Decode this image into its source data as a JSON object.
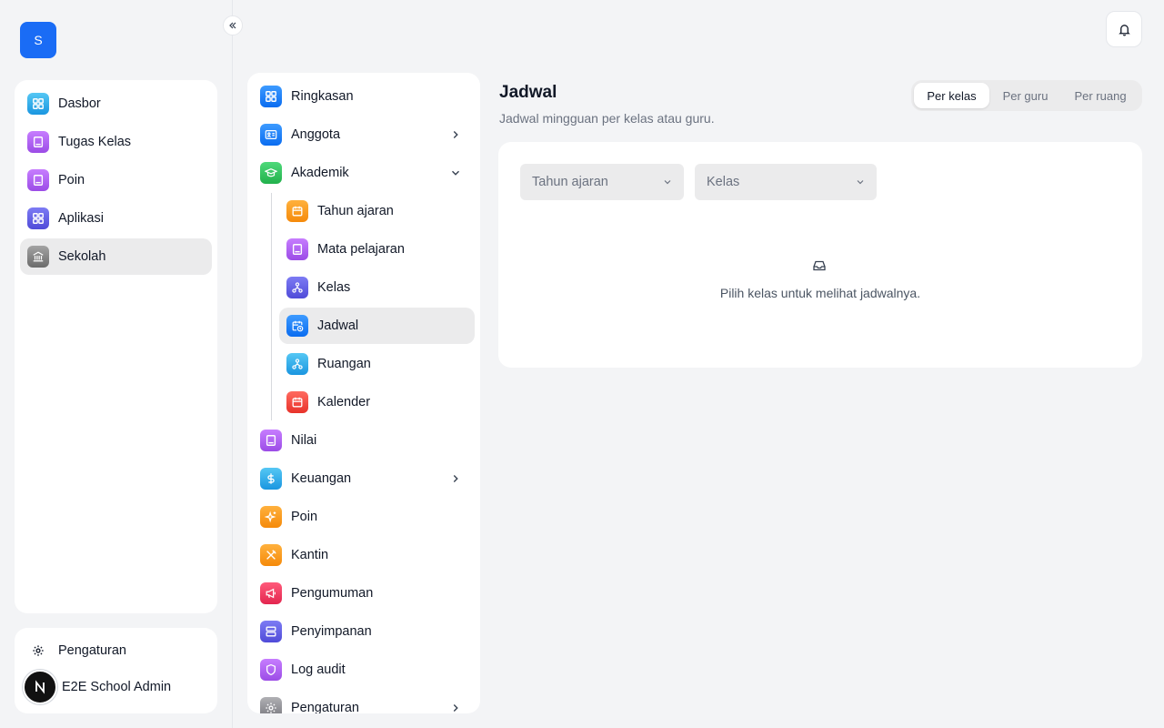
{
  "app": {
    "logo_letter": "S"
  },
  "rail": {
    "items": [
      {
        "label": "Dasbor",
        "icon": "grid-icon",
        "active": false
      },
      {
        "label": "Tugas Kelas",
        "icon": "book-icon",
        "active": false
      },
      {
        "label": "Poin",
        "icon": "book-icon",
        "active": false
      },
      {
        "label": "Aplikasi",
        "icon": "grid-icon",
        "active": false
      },
      {
        "label": "Sekolah",
        "icon": "school-icon",
        "active": true
      }
    ],
    "settings_label": "Pengaturan",
    "user_name": "E2E School Admin",
    "user_initial": "N"
  },
  "subnav": {
    "items": [
      {
        "label": "Ringkasan"
      },
      {
        "label": "Anggota"
      },
      {
        "label": "Akademik"
      }
    ],
    "akademik_children": [
      {
        "label": "Tahun ajaran"
      },
      {
        "label": "Mata pelajaran"
      },
      {
        "label": "Kelas"
      },
      {
        "label": "Jadwal",
        "active": true
      },
      {
        "label": "Ruangan"
      },
      {
        "label": "Kalender"
      }
    ],
    "items_after": [
      {
        "label": "Nilai"
      },
      {
        "label": "Keuangan"
      },
      {
        "label": "Poin"
      },
      {
        "label": "Kantin"
      },
      {
        "label": "Pengumuman"
      },
      {
        "label": "Penyimpanan"
      },
      {
        "label": "Log audit"
      },
      {
        "label": "Pengaturan"
      }
    ]
  },
  "main": {
    "title": "Jadwal",
    "subtitle": "Jadwal mingguan per kelas atau guru.",
    "view_tabs": [
      {
        "label": "Per kelas",
        "active": true
      },
      {
        "label": "Per guru",
        "active": false
      },
      {
        "label": "Per ruang",
        "active": false
      }
    ],
    "filters": {
      "year_placeholder": "Tahun ajaran",
      "class_placeholder": "Kelas"
    },
    "empty_message": "Pilih kelas untuk melihat jadwalnya."
  },
  "colors": {
    "accent": "#1a6cf5",
    "page_bg": "#f3f4f6",
    "active_bg": "#ebebec"
  }
}
